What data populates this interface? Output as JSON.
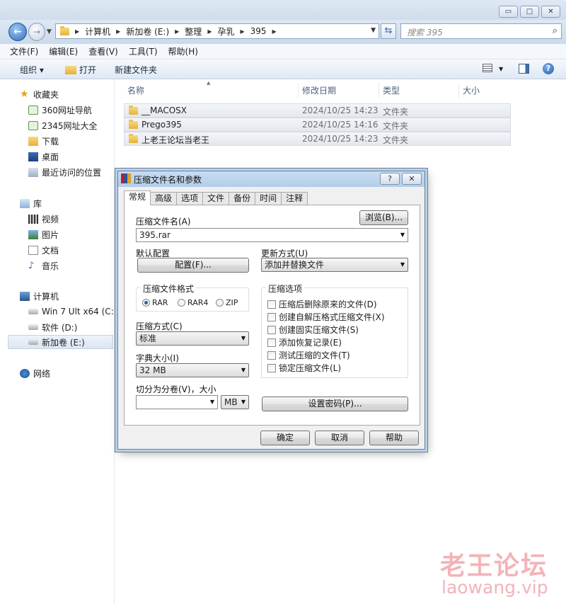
{
  "window": {
    "caption_min": "▭",
    "caption_max": "□",
    "caption_close": "✕"
  },
  "address": {
    "segments": [
      "计算机",
      "新加卷 (E:)",
      "整理",
      "孕乳",
      "395"
    ]
  },
  "search": {
    "placeholder": "搜索 395"
  },
  "menu": [
    "文件(F)",
    "编辑(E)",
    "查看(V)",
    "工具(T)",
    "帮助(H)"
  ],
  "toolbar": {
    "organize": "组织 ▾",
    "open": "打开",
    "new_folder": "新建文件夹"
  },
  "nav": {
    "favorites": "收藏夹",
    "fav_items": [
      "360网址导航",
      "2345网址大全",
      "下载",
      "桌面",
      "最近访问的位置"
    ],
    "libraries": "库",
    "lib_items": [
      "视频",
      "图片",
      "文档",
      "音乐"
    ],
    "computer": "计算机",
    "drives": [
      "Win 7 Ult x64 (C:)",
      "软件 (D:)",
      "新加卷 (E:)"
    ],
    "network": "网络"
  },
  "columns": {
    "name": "名称",
    "date": "修改日期",
    "type": "类型",
    "size": "大小"
  },
  "files": [
    {
      "name": "__MACOSX",
      "date": "2024/10/25 14:23",
      "type": "文件夹"
    },
    {
      "name": "Prego395",
      "date": "2024/10/25 14:16",
      "type": "文件夹"
    },
    {
      "name": "上老王论坛当老王",
      "date": "2024/10/25 14:23",
      "type": "文件夹"
    }
  ],
  "dialog": {
    "title": "压缩文件名和参数",
    "help_btn": "?",
    "close_btn": "✕",
    "tabs": [
      "常规",
      "高级",
      "选项",
      "文件",
      "备份",
      "时间",
      "注释"
    ],
    "archive_name_label": "压缩文件名(A)",
    "browse_btn": "浏览(B)...",
    "archive_name_value": "395.rar",
    "default_profile_label": "默认配置",
    "profile_btn": "配置(F)...",
    "update_mode_label": "更新方式(U)",
    "update_mode_value": "添加并替换文件",
    "format_group": "压缩文件格式",
    "formats": [
      "RAR",
      "RAR4",
      "ZIP"
    ],
    "method_label": "压缩方式(C)",
    "method_value": "标准",
    "dict_label": "字典大小(I)",
    "dict_value": "32 MB",
    "split_label": "切分为分卷(V)，大小",
    "split_value": "",
    "split_unit": "MB",
    "options_group": "压缩选项",
    "options": [
      "压缩后删除原来的文件(D)",
      "创建自解压格式压缩文件(X)",
      "创建固实压缩文件(S)",
      "添加恢复记录(E)",
      "测试压缩的文件(T)",
      "锁定压缩文件(L)"
    ],
    "password_btn": "设置密码(P)...",
    "ok_btn": "确定",
    "cancel_btn": "取消",
    "help_btn2": "帮助"
  },
  "watermark": {
    "cn": "老王论坛",
    "url": "laowang.vip"
  }
}
